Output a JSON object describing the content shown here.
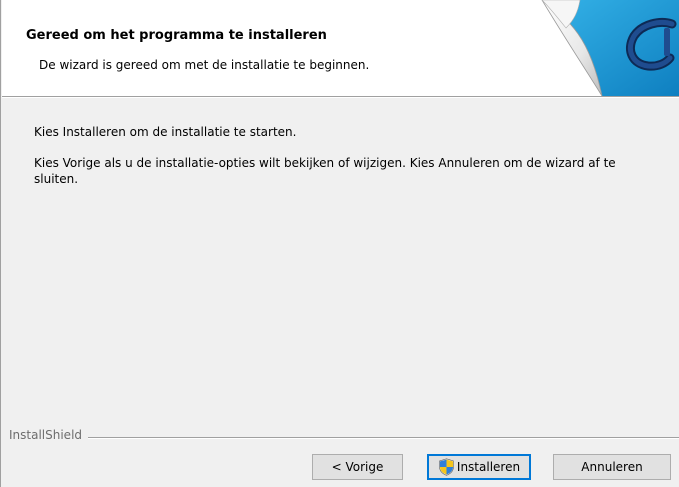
{
  "header": {
    "title": "Gereed om het programma te installeren",
    "subtitle": "De wizard is gereed om met de installatie te beginnen."
  },
  "body": {
    "line1": "Kies Installeren om de installatie te starten.",
    "line2": "Kies Vorige als u de installatie-opties wilt bekijken of wijzigen. Kies Annuleren om de wizard af te sluiten."
  },
  "footer": {
    "brand_label": "InstallShield"
  },
  "buttons": {
    "back_label": "< Vorige",
    "install_label": "Installeren",
    "install_icon": "uac-shield-icon",
    "cancel_label": "Annuleren"
  },
  "colors": {
    "dialog_background": "#f0f0f0",
    "header_background": "#ffffff",
    "default_button_border": "#0078d7",
    "logo_blue": "#1a9ad6"
  }
}
